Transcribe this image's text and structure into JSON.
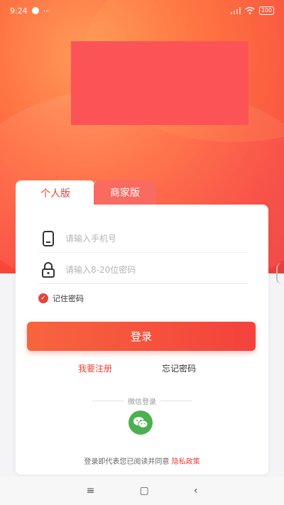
{
  "status_bar": {
    "time": "9:24",
    "dots": "···",
    "battery": "100"
  },
  "tabs": {
    "personal": "个人版",
    "business": "商家版"
  },
  "form": {
    "phone_placeholder": "请输入手机号",
    "password_placeholder": "请输入8-20位密码",
    "remember_label": "记住密码",
    "login_label": "登录",
    "register_label": "我要注册",
    "forgot_label": "忘记密码"
  },
  "social": {
    "label": "微信登录"
  },
  "agreement": {
    "text": "登录即代表您已阅读并同意",
    "policy": "隐私政策"
  },
  "nav": {
    "menu": "≡",
    "home": "▢",
    "back": "‹"
  },
  "colors": {
    "accent": "#e8433a",
    "banner": "#fc5357",
    "wechat": "#4caf50"
  }
}
